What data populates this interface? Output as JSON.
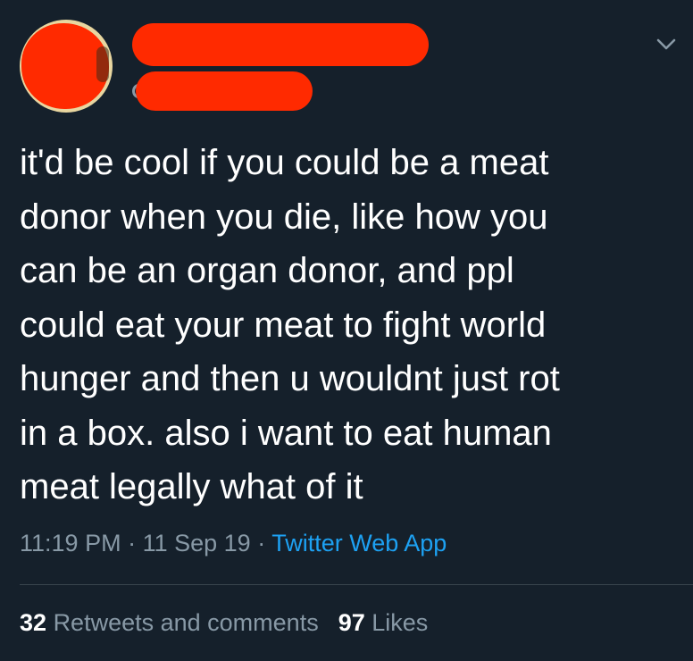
{
  "tweet": {
    "text": "it'd be cool if you could be a meat\ndonor when you die, like how you\ncan be an organ donor, and ppl\ncould eat your meat to fight world\nhunger and then u wouldnt just rot\nin a box. also i want to eat human\nmeat legally what of it",
    "time": "11:19 PM",
    "separator": " · ",
    "date": "11 Sep 19",
    "source": "Twitter Web App"
  },
  "stats": {
    "retweets_count": "32",
    "retweets_label": "Retweets and comments",
    "likes_count": "97",
    "likes_label": "Likes"
  },
  "icons": {
    "menu": "chevron-down-icon"
  },
  "colors": {
    "background": "#15202b",
    "text": "#ffffff",
    "secondary_text": "#8899a6",
    "link": "#1da1f2",
    "divider": "#38444d",
    "redaction": "#ff2a00"
  }
}
